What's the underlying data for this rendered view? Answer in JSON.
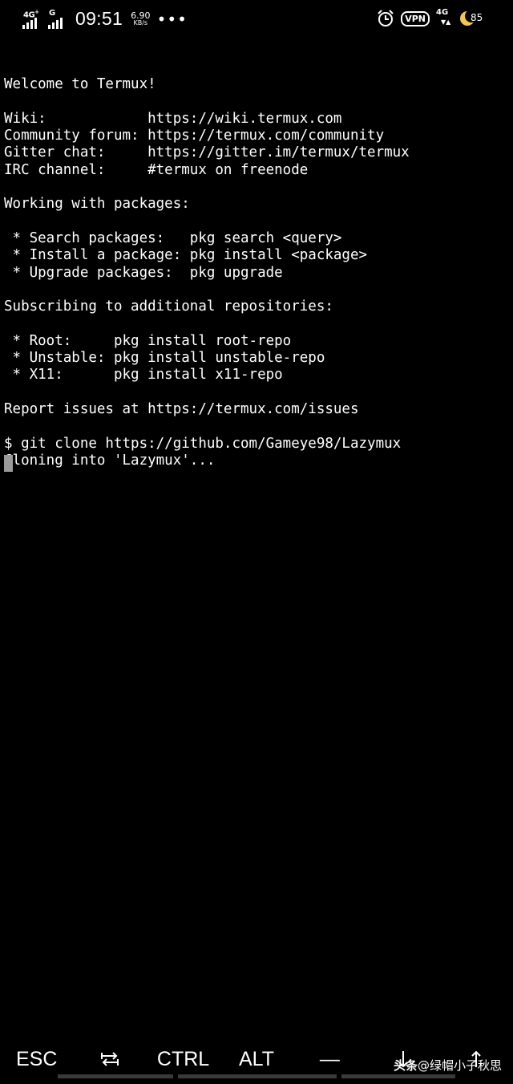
{
  "status_bar": {
    "signal1_label": "4G",
    "signal1_arrows": "+",
    "signal2_label": "G",
    "time": "09:51",
    "speed_value": "6.90",
    "speed_unit": "KB/s",
    "more": "•••",
    "vpn_label": "VPN",
    "signal3_label": "4G",
    "signal3_arrows": "▼▲",
    "battery_level": "85"
  },
  "terminal": {
    "lines": [
      "",
      "Welcome to Termux!",
      "",
      "Wiki:            https://wiki.termux.com",
      "Community forum: https://termux.com/community",
      "Gitter chat:     https://gitter.im/termux/termux",
      "IRC channel:     #termux on freenode",
      "",
      "Working with packages:",
      "",
      " * Search packages:   pkg search <query>",
      " * Install a package: pkg install <package>",
      " * Upgrade packages:  pkg upgrade",
      "",
      "Subscribing to additional repositories:",
      "",
      " * Root:     pkg install root-repo",
      " * Unstable: pkg install unstable-repo",
      " * X11:      pkg install x11-repo",
      "",
      "Report issues at https://termux.com/issues",
      "",
      "$ git clone https://github.com/Gameye98/Lazymux",
      "Cloning into 'Lazymux'..."
    ]
  },
  "extra_keys": {
    "esc": "ESC",
    "tab_icon": "tab-icon",
    "ctrl": "CTRL",
    "alt": "ALT",
    "dash": "—",
    "down_icon": "arrow-down-icon",
    "up_icon": "arrow-up-icon"
  },
  "watermark": {
    "brand": "头条",
    "handle": "@绿帽小子秋思"
  }
}
